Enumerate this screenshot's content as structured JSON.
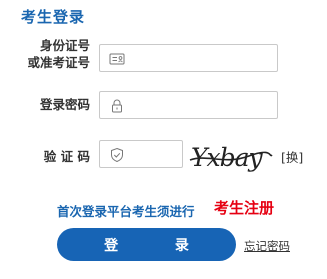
{
  "title": "考生登录",
  "id_field": {
    "label_line1": "身份证号",
    "label_line2": "或准考证号",
    "value": "",
    "icon": "id-card-icon"
  },
  "password_field": {
    "label": "登录密码",
    "value": "",
    "icon": "lock-icon"
  },
  "captcha_field": {
    "label": "验 证 码",
    "value": "",
    "icon": "shield-check-icon",
    "image_text": "Yxbay",
    "refresh_label": "[换]"
  },
  "first_login_prefix": "首次登录平台考生须进行",
  "register_label": "考生注册",
  "login_button": "登 录",
  "forgot_password": "忘记密码",
  "colors": {
    "accent": "#1a66b0",
    "button": "#1764b5",
    "register": "#e60012"
  }
}
